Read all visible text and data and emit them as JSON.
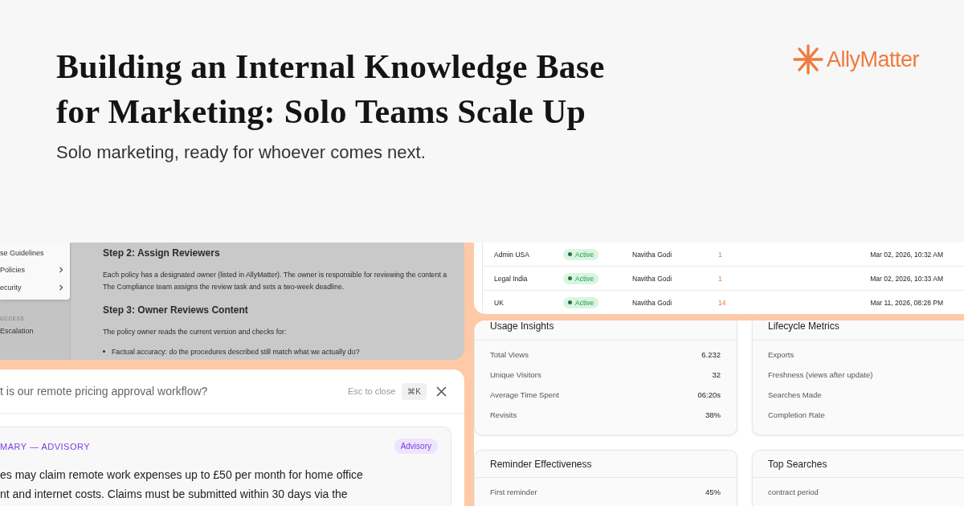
{
  "header": {
    "title_lines": [
      "Building an Internal Knowledge Base",
      "for Marketing: Solo Teams Scale Up"
    ],
    "subtitle": "Solo marketing, ready for whoever comes next.",
    "logo": "AllyMatter"
  },
  "document_view": {
    "sidebar": {
      "items": [
        {
          "label": "se Guidelines",
          "has_submenu": false
        },
        {
          "label": "Policies",
          "has_submenu": true
        },
        {
          "label": "ecurity",
          "has_submenu": true
        }
      ],
      "section_heading": "UCCESS",
      "section_items": [
        {
          "label": "Escalation"
        }
      ]
    },
    "content": [
      {
        "kind": "heading",
        "lines": [
          "Step 2: Assign Reviewers"
        ]
      },
      {
        "kind": "paragraph",
        "lines": [
          "Each policy has a designated owner (listed in AllyMatter). The owner is responsible for reviewing the content a",
          "The Compliance team assigns the review task and sets a two-week deadline."
        ]
      },
      {
        "kind": "heading",
        "lines": [
          "Step 3: Owner Reviews Content"
        ]
      },
      {
        "kind": "paragraph",
        "lines": [
          "The policy owner reads the current version and checks for:"
        ]
      },
      {
        "kind": "bullet",
        "lines": [
          "Factual accuracy: do the procedures described still match what we actually do?"
        ]
      }
    ]
  },
  "search_modal": {
    "query": "t is our remote pricing approval workflow?",
    "hint": "Esc to close",
    "shortcut": "⌘K",
    "summary": {
      "label": "MARY — ADVISORY",
      "badge": "Advisory",
      "lines": [
        "es may claim remote work expenses up to £50 per month for home office",
        "nt and internet costs. Claims must be submitted within 30 days via the"
      ]
    }
  },
  "table": {
    "rows": [
      {
        "name": "Admin USA",
        "status": "Active",
        "owner": "Navitha Godi",
        "count": "1",
        "date": "Mar 02, 2026, 10:32 AM"
      },
      {
        "name": "Legal India",
        "status": "Active",
        "owner": "Navitha Godi",
        "count": "1",
        "date": "Mar 02, 2026, 10:33 AM"
      },
      {
        "name": "UK",
        "status": "Active",
        "owner": "Navitha Godi",
        "count": "14",
        "date": "Mar 11, 2026, 08:28 PM"
      }
    ]
  },
  "insight_cards": [
    {
      "title": "Usage Insights",
      "rows": [
        {
          "label": "Total Views",
          "value": "6.232"
        },
        {
          "label": "Unique Visitors",
          "value": "32"
        },
        {
          "label": "Average Time Spent",
          "value": "06:20s"
        },
        {
          "label": "Revisits",
          "value": "38%"
        }
      ]
    },
    {
      "title": "Lifecycle Metrics",
      "rows": [
        {
          "label": "Exports"
        },
        {
          "label": "Freshness (views after update)"
        },
        {
          "label": "Searches Made"
        },
        {
          "label": "Completion Rate"
        }
      ]
    },
    {
      "title": "Reminder Effectiveness",
      "rows": [
        {
          "label": "First reminder",
          "value": "45%"
        }
      ]
    },
    {
      "title": "Top Searches",
      "rows": [
        {
          "label": "contract period"
        }
      ]
    }
  ]
}
